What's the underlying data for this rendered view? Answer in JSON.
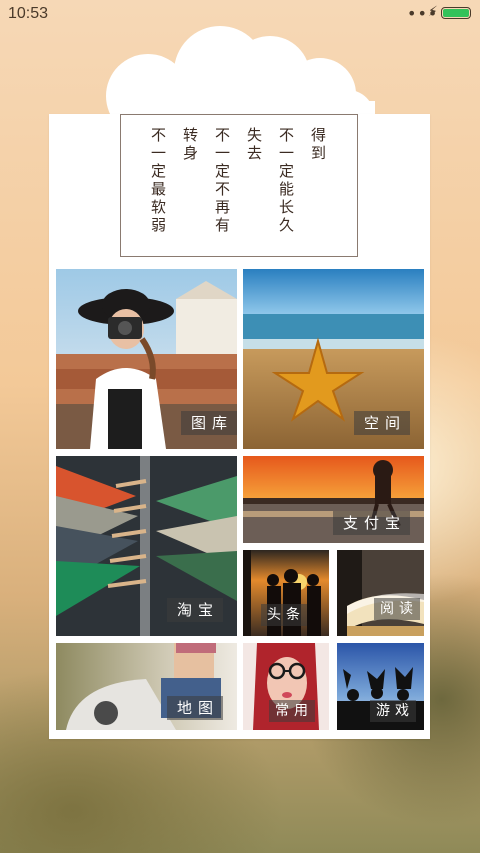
{
  "status_bar": {
    "time": "10:53",
    "dots": "•••",
    "charge_icon": "⚡",
    "battery_color": "#32c25a"
  },
  "poem": {
    "lines": [
      "得到",
      "不一定能长久",
      "失去",
      "不一定不再有",
      "转身",
      "不一定最软弱"
    ]
  },
  "tiles": [
    {
      "id": "gallery",
      "label": "图库"
    },
    {
      "id": "space",
      "label": "空间"
    },
    {
      "id": "alipay",
      "label": "支付宝"
    },
    {
      "id": "taobao",
      "label": "淘宝"
    },
    {
      "id": "headlines",
      "label": "头条"
    },
    {
      "id": "reading",
      "label": "阅读"
    },
    {
      "id": "map",
      "label": "地图"
    },
    {
      "id": "common",
      "label": "常用"
    },
    {
      "id": "games",
      "label": "游戏"
    }
  ]
}
